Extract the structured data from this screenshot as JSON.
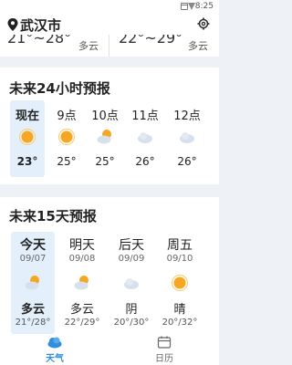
{
  "status": {
    "time": "8:25"
  },
  "header": {
    "city": "武汉市"
  },
  "current_strip": {
    "left_temp": "21°~28°",
    "left_cond": "多云",
    "right_temp": "22°~29°",
    "right_cond": "多云"
  },
  "hourly": {
    "title": "未来24小时预报",
    "items": [
      {
        "label": "现在",
        "temp": "23°",
        "icon": "sun-icon"
      },
      {
        "label": "9点",
        "temp": "25°",
        "icon": "sun-icon"
      },
      {
        "label": "10点",
        "temp": "25°",
        "icon": "partly-cloudy-icon"
      },
      {
        "label": "11点",
        "temp": "26°",
        "icon": "cloud-icon"
      },
      {
        "label": "12点",
        "temp": "26°",
        "icon": "cloud-icon"
      }
    ]
  },
  "daily": {
    "title": "未来15天预报",
    "items": [
      {
        "name": "今天",
        "date": "09/07",
        "cond": "多云",
        "range": "21°/28°",
        "icon": "partly-cloudy-icon"
      },
      {
        "name": "明天",
        "date": "09/08",
        "cond": "多云",
        "range": "22°/29°",
        "icon": "partly-cloudy-icon"
      },
      {
        "name": "后天",
        "date": "09/09",
        "cond": "阴",
        "range": "20°/30°",
        "icon": "cloud-icon"
      },
      {
        "name": "周五",
        "date": "09/10",
        "cond": "晴",
        "range": "20°/32°",
        "icon": "sun-icon"
      }
    ]
  },
  "nav": {
    "weather_label": "天气",
    "calendar_label": "日历"
  },
  "colors": {
    "accent": "#2f8fdc",
    "active_bg": "#e3f0fb",
    "sun": "#f5a623",
    "cloud": "#cfd8e3"
  }
}
